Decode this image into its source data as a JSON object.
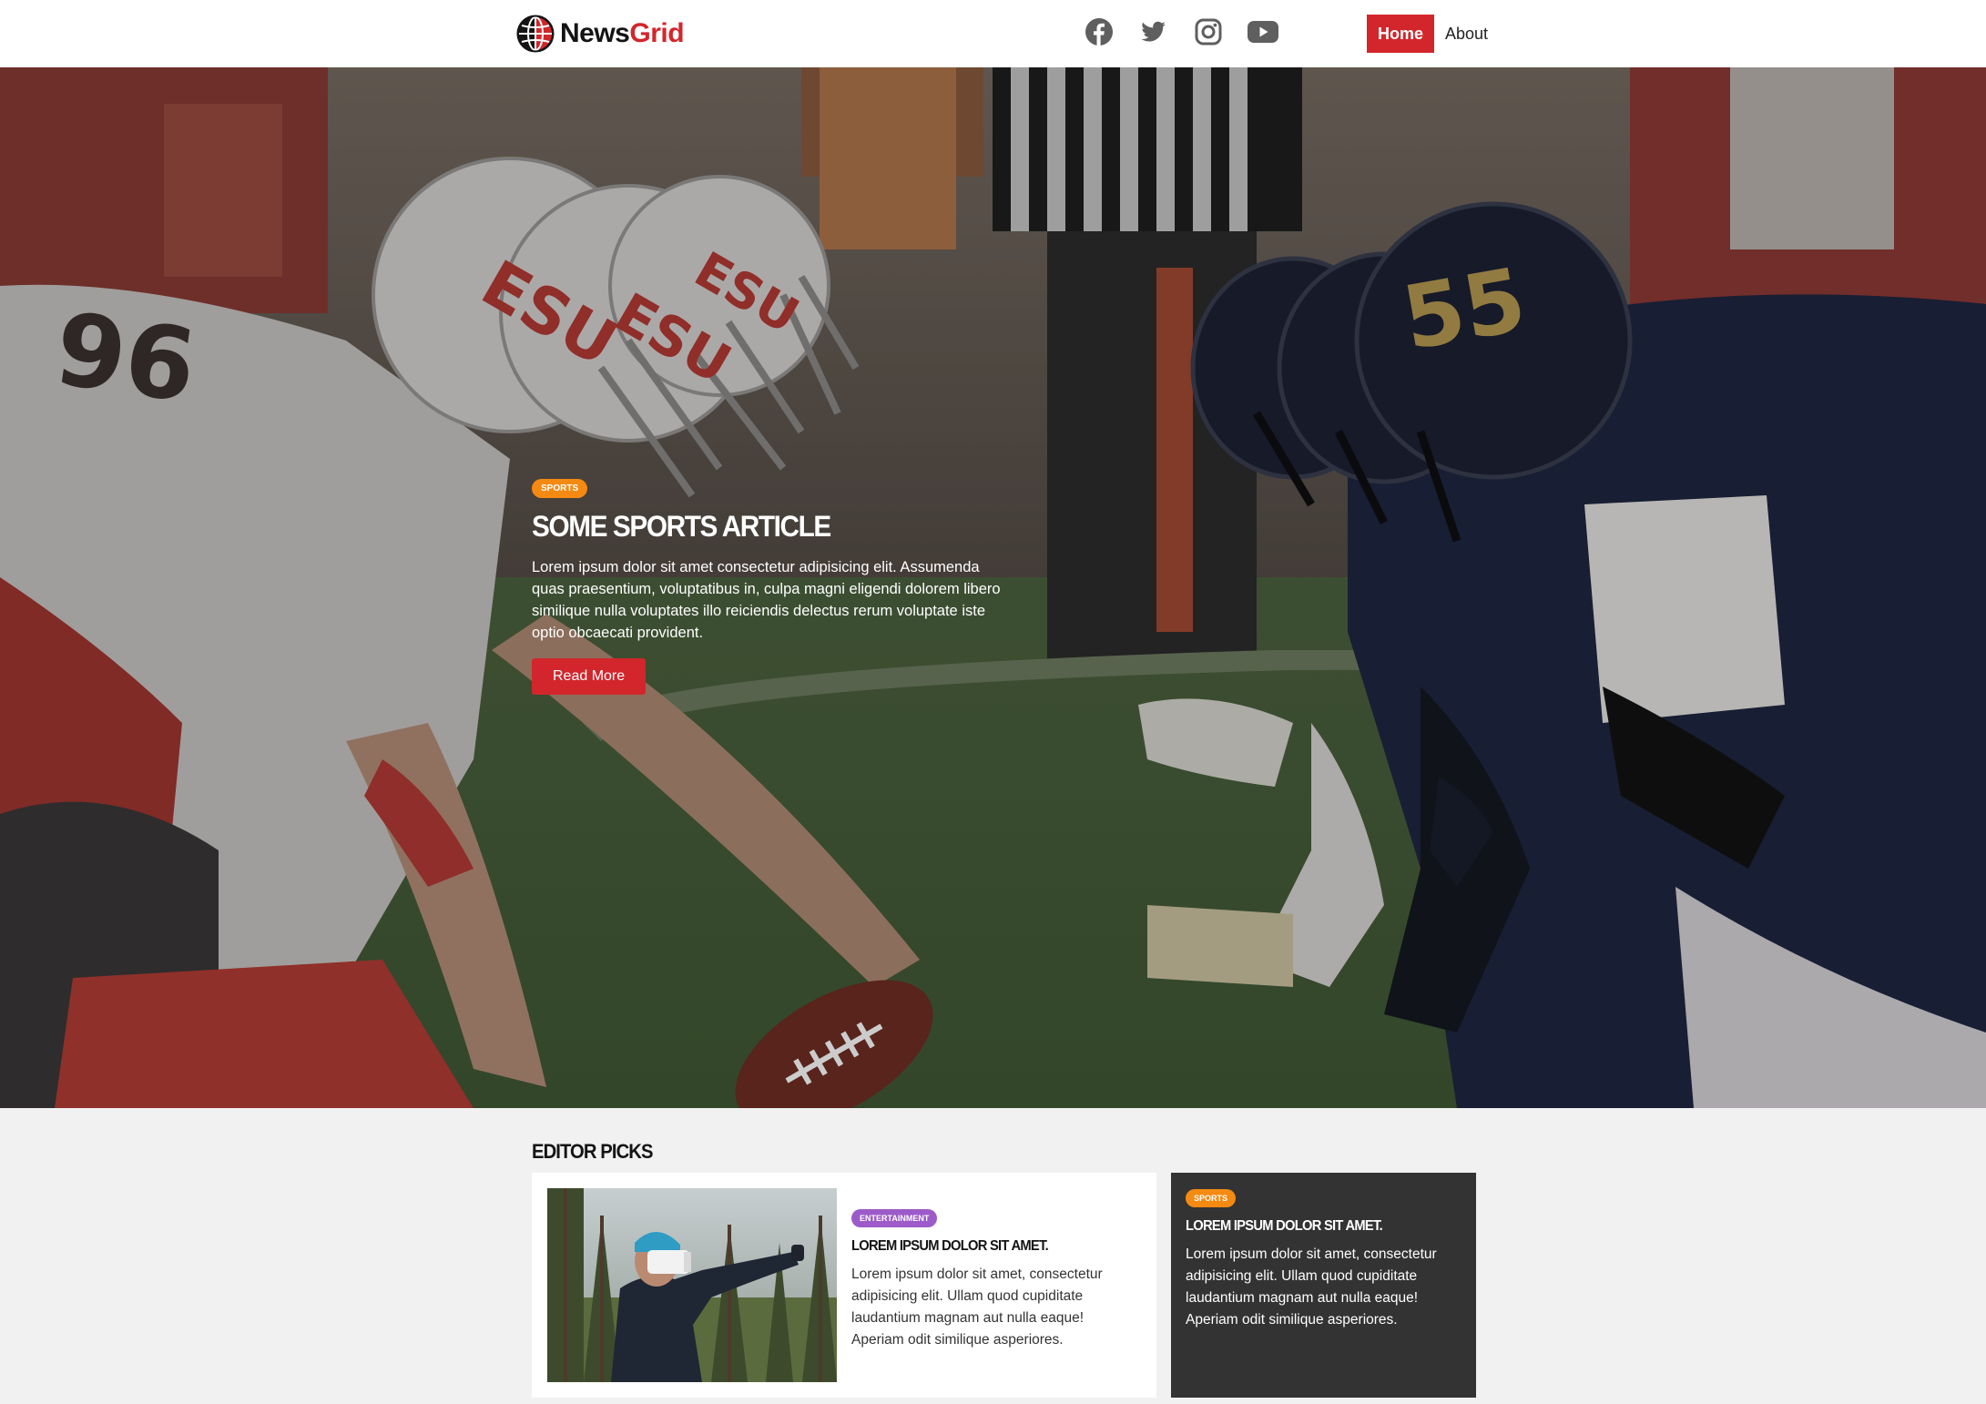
{
  "brand": {
    "name_part1": "News",
    "name_part2": "Grid",
    "accent_color": "#d3262c"
  },
  "social": [
    {
      "icon": "facebook-icon"
    },
    {
      "icon": "twitter-icon"
    },
    {
      "icon": "instagram-icon"
    },
    {
      "icon": "youtube-icon"
    }
  ],
  "nav": {
    "home_label": "Home",
    "about_label": "About"
  },
  "hero": {
    "tag": "Sports",
    "title": "Some Sports Article",
    "text": "Lorem ipsum dolor sit amet consectetur adipisicing elit. Assumenda quas praesentium, voluptatibus in, culpa magni eligendi dolorem libero similique nulla voluptates illo reiciendis delectus rerum voluptate iste optio obcaecati provident.",
    "button_label": "Read More"
  },
  "editor_picks": {
    "title": "Editor Picks",
    "cards": [
      {
        "tag": "Entertainment",
        "title": "Lorem ipsum dolor sit amet.",
        "text": "Lorem ipsum dolor sit amet, consectetur adipisicing elit. Ullam quod cupiditate laudantium magnam aut nulla eaque! Aperiam odit similique asperiores."
      },
      {
        "tag": "Sports",
        "title": "Lorem ipsum dolor sit amet.",
        "text": "Lorem ipsum dolor sit amet, consectetur adipisicing elit. Ullam quod cupiditate laudantium magnam aut nulla eaque! Aperiam odit similique asperiores."
      }
    ]
  },
  "colors": {
    "sports_tag": "#f48a12",
    "entertainment_tag": "#9c5bc9",
    "dark_card": "#333333"
  }
}
